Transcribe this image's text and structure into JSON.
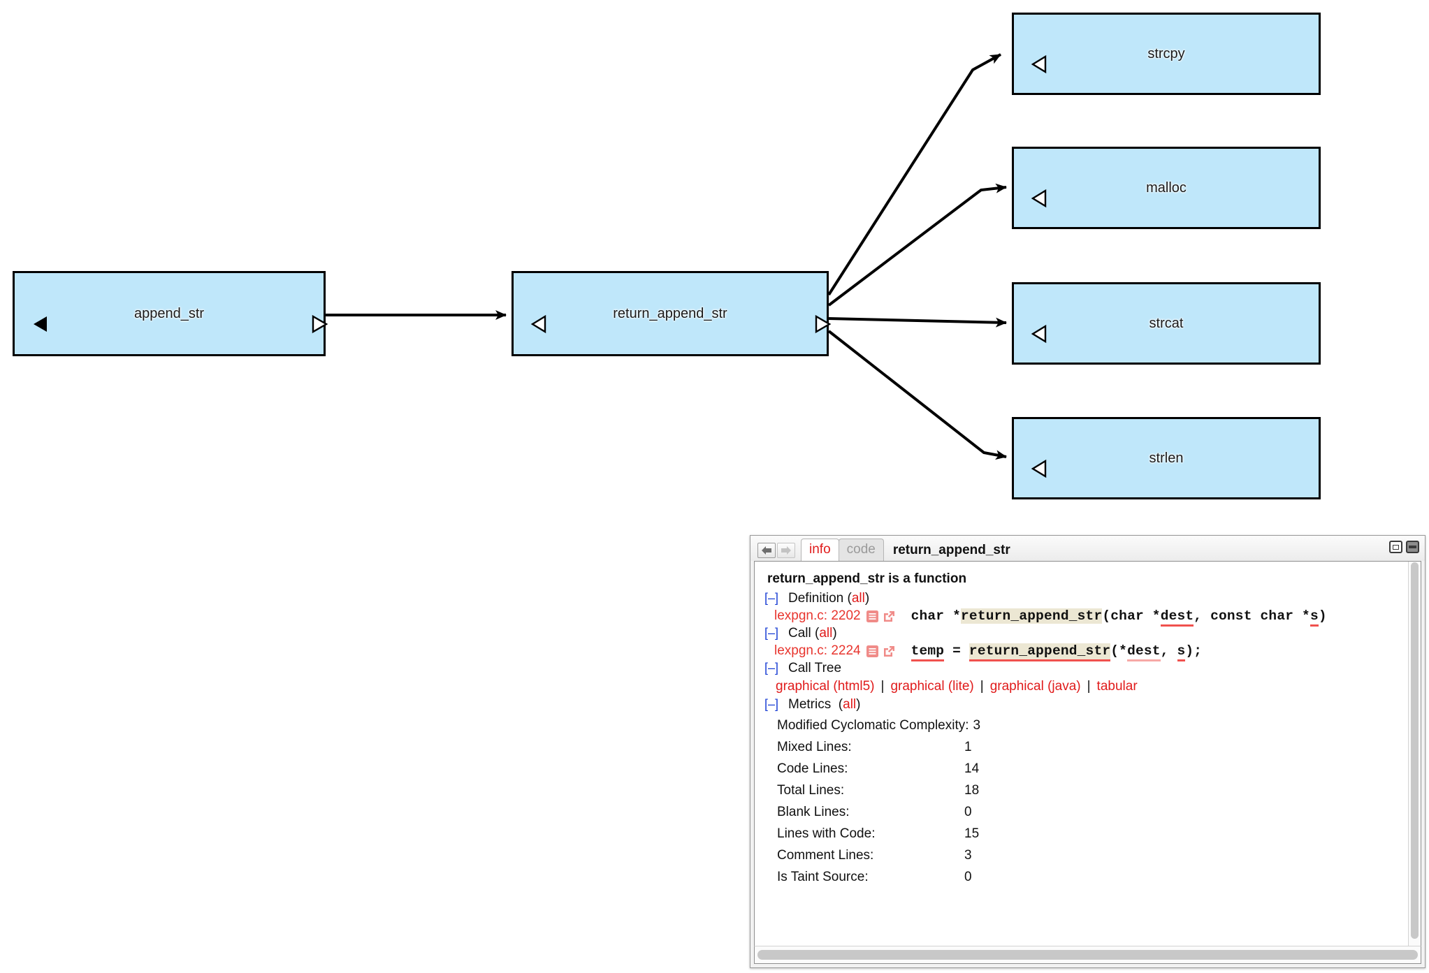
{
  "graph": {
    "nodes": [
      {
        "id": "append_str",
        "label": "append_str",
        "left_tri": "filled",
        "right_tri": "hollow"
      },
      {
        "id": "return_append_str",
        "label": "return_append_str",
        "left_tri": "hollow",
        "right_tri": "hollow"
      },
      {
        "id": "strcpy",
        "label": "strcpy",
        "left_tri": "hollow",
        "right_tri": "none"
      },
      {
        "id": "malloc",
        "label": "malloc",
        "left_tri": "hollow",
        "right_tri": "none"
      },
      {
        "id": "strcat",
        "label": "strcat",
        "left_tri": "hollow",
        "right_tri": "none"
      },
      {
        "id": "strlen",
        "label": "strlen",
        "left_tri": "hollow",
        "right_tri": "none"
      }
    ],
    "edges": [
      {
        "from": "append_str",
        "to": "return_append_str"
      },
      {
        "from": "return_append_str",
        "to": "strcpy"
      },
      {
        "from": "return_append_str",
        "to": "malloc"
      },
      {
        "from": "return_append_str",
        "to": "strcat"
      },
      {
        "from": "return_append_str",
        "to": "strlen"
      }
    ],
    "node_fill": "#bfe7fa",
    "node_border": "#000000"
  },
  "panel": {
    "nav": {
      "back": "back-arrow",
      "forward": "forward-arrow"
    },
    "tabs": [
      {
        "id": "info",
        "label": "info",
        "active": true
      },
      {
        "id": "code",
        "label": "code",
        "active": false
      }
    ],
    "title": "return_append_str",
    "window_buttons": [
      "restore",
      "minimize"
    ],
    "heading": "return_append_str is a function",
    "sections": {
      "definition": {
        "toggle": "[–]",
        "label": "Definition",
        "all": "all",
        "source": "lexpgn.c: 2202",
        "code": [
          {
            "t": "char *",
            "hl": false,
            "u": "none"
          },
          {
            "t": "return_append_str",
            "hl": true,
            "u": "none"
          },
          {
            "t": "(char *",
            "hl": false,
            "u": "none"
          },
          {
            "t": "dest",
            "hl": false,
            "u": "strong"
          },
          {
            "t": ", const char *",
            "hl": false,
            "u": "none"
          },
          {
            "t": "s",
            "hl": false,
            "u": "strong"
          },
          {
            "t": ")",
            "hl": false,
            "u": "none"
          }
        ]
      },
      "call": {
        "toggle": "[–]",
        "label": "Call",
        "all": "all",
        "source": "lexpgn.c: 2224",
        "code": [
          {
            "t": "temp",
            "hl": false,
            "u": "strong"
          },
          {
            "t": " = ",
            "hl": false,
            "u": "none"
          },
          {
            "t": "return_append_str",
            "hl": true,
            "u": "strong"
          },
          {
            "t": "(*",
            "hl": false,
            "u": "none"
          },
          {
            "t": "dest",
            "hl": false,
            "u": "light"
          },
          {
            "t": ", ",
            "hl": false,
            "u": "none"
          },
          {
            "t": "s",
            "hl": false,
            "u": "strong"
          },
          {
            "t": ");",
            "hl": false,
            "u": "none"
          }
        ]
      },
      "call_tree": {
        "toggle": "[–]",
        "label": "Call Tree",
        "links": [
          "graphical (html5)",
          "graphical (lite)",
          "graphical (java)",
          "tabular"
        ],
        "separator": "|"
      },
      "metrics": {
        "toggle": "[–]",
        "label": "Metrics",
        "all": "all",
        "items": [
          {
            "name": "Modified Cyclomatic Complexity:",
            "value": "3",
            "inline": true
          },
          {
            "name": "Mixed Lines:",
            "value": "1",
            "inline": false
          },
          {
            "name": "Code Lines:",
            "value": "14",
            "inline": false
          },
          {
            "name": "Total Lines:",
            "value": "18",
            "inline": false
          },
          {
            "name": "Blank Lines:",
            "value": "0",
            "inline": false
          },
          {
            "name": "Lines with Code:",
            "value": "15",
            "inline": false
          },
          {
            "name": "Comment Lines:",
            "value": "3",
            "inline": false
          },
          {
            "name": "Is Taint Source:",
            "value": "0",
            "inline": false
          }
        ]
      }
    },
    "colors": {
      "link_red": "#e01b1b",
      "source_red": "#e8352e",
      "toggle_blue": "#1a3fd4",
      "highlight": "#ece7d3",
      "underline_strong": "#f0514e",
      "underline_light": "#f7a8a6"
    }
  }
}
